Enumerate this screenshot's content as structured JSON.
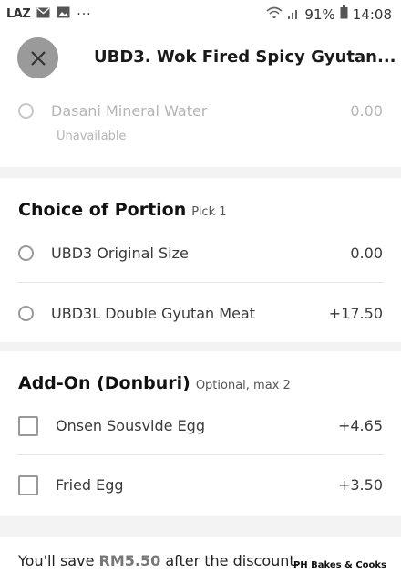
{
  "status_bar": {
    "app_icon_text": "LAZ",
    "battery": "91%",
    "time": "14:08"
  },
  "header": {
    "title": "UBD3. Wok Fired Spicy Gyutan..."
  },
  "drinks": {
    "items": [
      {
        "label": "Dasani Mineral Water",
        "price": "0.00",
        "note": "Unavailable"
      }
    ]
  },
  "portion": {
    "title": "Choice of Portion",
    "subtitle": "Pick 1",
    "items": [
      {
        "label": "UBD3 Original Size",
        "price": "0.00"
      },
      {
        "label": "UBD3L Double Gyutan Meat",
        "price": "+17.50"
      }
    ]
  },
  "addon": {
    "title": "Add-On (Donburi)",
    "subtitle": "Optional, max 2",
    "items": [
      {
        "label": "Onsen Sousvide Egg",
        "price": "+4.65"
      },
      {
        "label": "Fried Egg",
        "price": "+3.50"
      }
    ]
  },
  "footer": {
    "save_prefix": "You'll save",
    "save_amount": "RM5.50",
    "save_suffix": "after the discount.",
    "watermark": "PH Bakes & Cooks"
  }
}
